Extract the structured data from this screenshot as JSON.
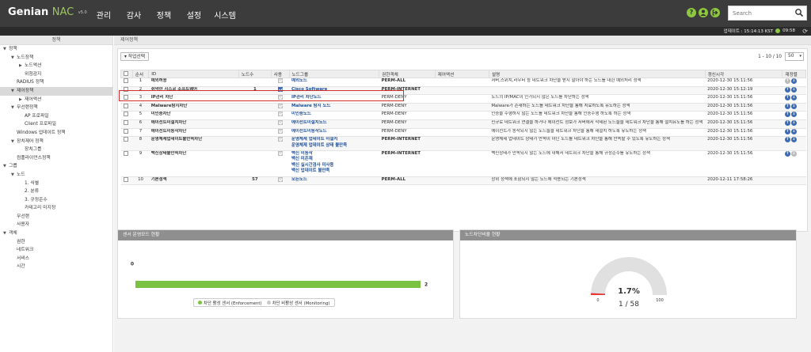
{
  "brand": {
    "name": "Genian",
    "product": "NAC",
    "version": "v5.0"
  },
  "menu": [
    "관리",
    "감사",
    "정책",
    "설정",
    "시스템"
  ],
  "search": {
    "placeholder": "Search"
  },
  "status": {
    "update": "업데이트 : 15:14:13 KST",
    "time": "09:58"
  },
  "sidebar": {
    "header": "정책",
    "items": [
      {
        "label": "정책",
        "level": 0,
        "arrow": "▼"
      },
      {
        "label": "노드정책",
        "level": 1,
        "arrow": "▼"
      },
      {
        "label": "노드액션",
        "level": 2,
        "arrow": "▶"
      },
      {
        "label": "위험감지",
        "level": 2,
        "arrow": ""
      },
      {
        "label": "RADIUS 정책",
        "level": 1,
        "arrow": ""
      },
      {
        "label": "제어정책",
        "level": 1,
        "arrow": "▼",
        "selected": true
      },
      {
        "label": "제어액션",
        "level": 2,
        "arrow": "▶"
      },
      {
        "label": "무선랜정책",
        "level": 1,
        "arrow": "▼"
      },
      {
        "label": "AP 프로파일",
        "level": 2,
        "arrow": ""
      },
      {
        "label": "Client 프로파일",
        "level": 2,
        "arrow": ""
      },
      {
        "label": "Windows 업데이트 정책",
        "level": 1,
        "arrow": ""
      },
      {
        "label": "장치제어 정책",
        "level": 1,
        "arrow": "▼"
      },
      {
        "label": "장치그룹",
        "level": 2,
        "arrow": ""
      },
      {
        "label": "컴플라이언스정책",
        "level": 1,
        "arrow": ""
      },
      {
        "label": "그룹",
        "level": 0,
        "arrow": "▼"
      },
      {
        "label": "노드",
        "level": 1,
        "arrow": "▼"
      },
      {
        "label": "1. 식별",
        "level": 2,
        "arrow": ""
      },
      {
        "label": "2. 분류",
        "level": 2,
        "arrow": ""
      },
      {
        "label": "3. 규정준수",
        "level": 2,
        "arrow": ""
      },
      {
        "label": "카테고리 미지정",
        "level": 2,
        "arrow": ""
      },
      {
        "label": "무선랜",
        "level": 1,
        "arrow": ""
      },
      {
        "label": "사용자",
        "level": 1,
        "arrow": ""
      },
      {
        "label": "객체",
        "level": 0,
        "arrow": "▼"
      },
      {
        "label": "권한",
        "level": 1,
        "arrow": ""
      },
      {
        "label": "네트워크",
        "level": 1,
        "arrow": ""
      },
      {
        "label": "서비스",
        "level": 1,
        "arrow": ""
      },
      {
        "label": "시간",
        "level": 1,
        "arrow": ""
      }
    ]
  },
  "main": {
    "header": "제어정책",
    "task_button": "▾ 작업선택",
    "pagination": "1 - 10 / 10",
    "page_size": "50",
    "columns": [
      "",
      "순서",
      "ID",
      "노드수",
      "사용",
      "노드그룹",
      "권한객체",
      "제어액션",
      "설명",
      "갱신시각",
      "재정렬"
    ],
    "rows": [
      {
        "order": "1",
        "id": "예외허용",
        "count": "",
        "enabled": "gray",
        "groups": [
          "예외노드"
        ],
        "perm": "PERM-ALL",
        "action": "",
        "desc": "서버,스위치,라우터 등 네트워크 차단을 받지 말아야 하는 노드를 대한 예외처리 정책",
        "time": "2020-12-30 15:11:56",
        "reorder": "dis-dn"
      },
      {
        "order": "2",
        "id": "취약한 시스코 소프트웨어",
        "count": "1",
        "enabled": "on",
        "groups": [
          "Cisco Software"
        ],
        "perm": "PERM-INTERNET",
        "action": "",
        "desc": "",
        "time": "2020-12-30 15:12:19",
        "reorder": "up-dn"
      },
      {
        "order": "3",
        "id": "IP관리 차단",
        "count": "",
        "enabled": "off",
        "groups": [
          "IP관리 차단노드"
        ],
        "perm": "PERM-DENY",
        "action": "",
        "desc": "노드의 IP/MAC이 인가되지 않은 노드를 차단하는 정책",
        "time": "2020-12-30 15:11:56",
        "reorder": "up-dn"
      },
      {
        "order": "4",
        "id": "Malware탐지차단",
        "count": "",
        "enabled": "off",
        "groups": [
          "Malware 탐지 노드"
        ],
        "perm": "PERM-DENY",
        "action": "",
        "desc": "Malware가 존재하는 노드를 네트워크 차단을 통해 치료하도록 유도하는 정책",
        "time": "2020-12-30 15:11:56",
        "reorder": "up-dn"
      },
      {
        "order": "5",
        "id": "미인증차단",
        "count": "",
        "enabled": "off",
        "groups": [
          "미인증노드"
        ],
        "perm": "PERM-DENY",
        "action": "",
        "desc": "인증을 수행하지 않는 노드를 네트워크 차단을 통해 인증수행 하도록 하는 정책",
        "time": "2020-12-30 15:11:56",
        "reorder": "up-dn"
      },
      {
        "order": "6",
        "id": "에이전트미설치차단",
        "count": "",
        "enabled": "off",
        "groups": [
          "에이전트미설치노드"
        ],
        "perm": "PERM-DENY",
        "action": "",
        "desc": "신규로 네트워크 연결을 하거나 에이전트 정보가 서버에서 삭제된 노드들을 네트워크 차단을 통해 설치유도를 하는 정책",
        "time": "2020-12-30 15:11:56",
        "reorder": "up-dn"
      },
      {
        "order": "7",
        "id": "에이전트미동작차단",
        "count": "",
        "enabled": "off",
        "groups": [
          "에이전트미동작노드"
        ],
        "perm": "PERM-DENY",
        "action": "",
        "desc": "에이전트가 동작되지 않는 노드들을 네트워크 차단을 통해 재설치 하도록 유도하는 정책",
        "time": "2020-12-30 15:11:56",
        "reorder": "up-dn"
      },
      {
        "order": "8",
        "id": "운영체제업데이트불만족차단",
        "count": "",
        "enabled": "off",
        "groups": [
          "운영체제 업데이트 미설치",
          "운영체제 업데이트 상태 불만족"
        ],
        "perm": "PERM-INTERNET",
        "action": "",
        "desc": "운영체제 업데이트 상태가 만족이 아닌 노드를 네트워크 차단을 통해 만족할 수 있도록 유도하는 정책",
        "time": "2020-12-30 15:11:56",
        "reorder": "up-dn"
      },
      {
        "order": "9",
        "id": "백신상태불만족차단",
        "count": "",
        "enabled": "off",
        "groups": [
          "백신 미동작",
          "백신 미존재",
          "백신 실시간검사 미사용",
          "백신 업데이트 불만족"
        ],
        "perm": "PERM-INTERNET",
        "action": "",
        "desc": "백신상태가 만족되지 않는 노드에 대해서 네트워크 차단을 통해 규정준수를 유도하는 정책",
        "time": "2020-12-30 15:11:56",
        "reorder": "up-dis"
      },
      {
        "order": "10",
        "id": "기본정책",
        "count": "57",
        "enabled": "gray",
        "groups": [
          "모든노드"
        ],
        "perm": "PERM-ALL",
        "action": "",
        "desc": "상위 정책에 포함되지 않는 노드에 적용되는 기본정책",
        "time": "2020-12-11 17:58:26",
        "reorder": ""
      }
    ]
  },
  "sensor_panel": {
    "title": "센서 운영모드 현황",
    "legend": [
      {
        "label": "차단 활성 센서 (Enforcement)",
        "color": "#7cc242"
      },
      {
        "label": "차단 비활성 센서 (Monitoring)",
        "color": "#c8c8c8"
      }
    ]
  },
  "block_panel": {
    "title": "노드차단비율 현황",
    "percent_label": "1.7%",
    "ratio_label": "1 / 58",
    "min_label": "0",
    "max_label": "100"
  },
  "chart_data": [
    {
      "type": "bar",
      "categories": [
        "차단 활성 센서 (Enforcement)",
        "차단 비활성 센서 (Monitoring)"
      ],
      "values": [
        2,
        0
      ],
      "colors": [
        "#7cc242",
        "#c8c8c8"
      ],
      "orientation": "horizontal",
      "xlim": [
        0,
        2
      ]
    },
    {
      "type": "gauge",
      "value": 1.7,
      "min": 0,
      "max": 100,
      "numerator": 1,
      "denominator": 58,
      "fill_color": "#e53935",
      "track_color": "#e0e0e0"
    }
  ]
}
